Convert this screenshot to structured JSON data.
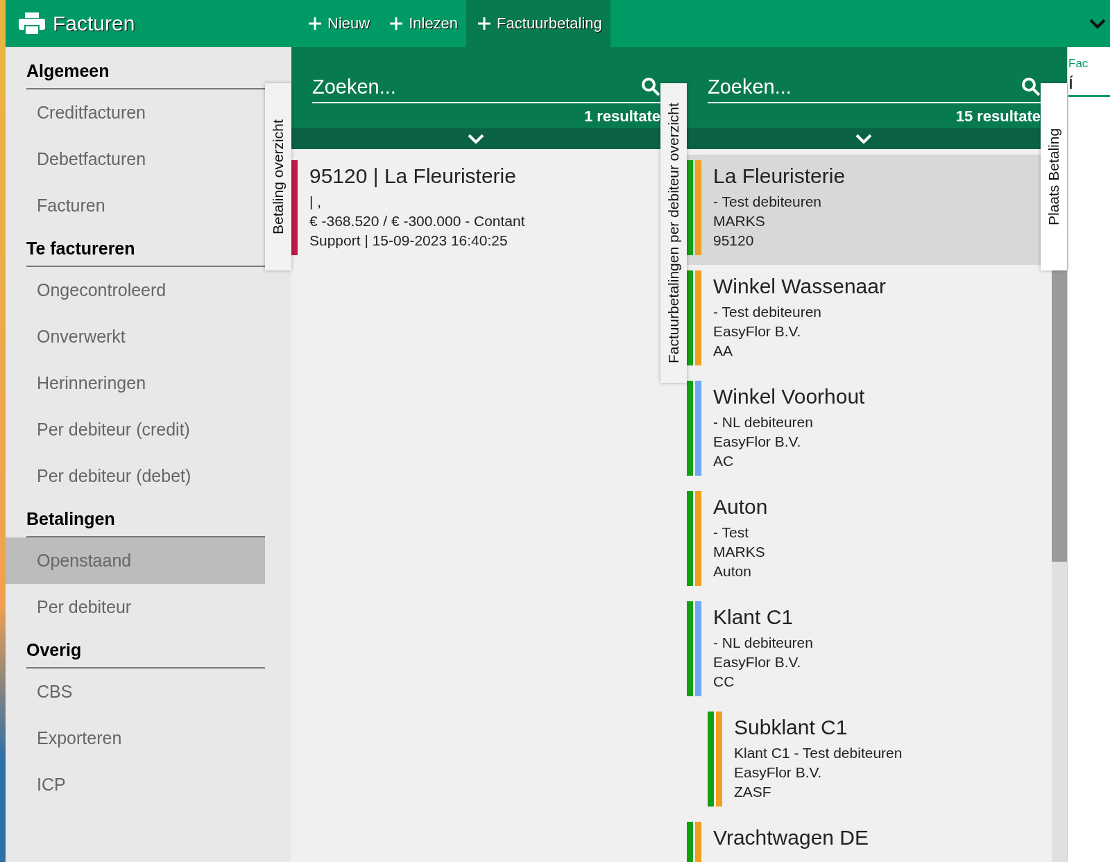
{
  "app": {
    "title": "Facturen"
  },
  "toolbar": [
    {
      "label": "Nieuw",
      "selected": false
    },
    {
      "label": "Inlezen",
      "selected": false
    },
    {
      "label": "Factuurbetaling",
      "selected": true
    }
  ],
  "sidebar": {
    "sections": [
      {
        "heading": "Algemeen",
        "items": [
          {
            "label": "Creditfacturen",
            "selected": false
          },
          {
            "label": "Debetfacturen",
            "selected": false
          },
          {
            "label": "Facturen",
            "selected": false
          }
        ]
      },
      {
        "heading": "Te factureren",
        "items": [
          {
            "label": "Ongecontroleerd",
            "selected": false
          },
          {
            "label": "Onverwerkt",
            "selected": false
          },
          {
            "label": "Herinneringen",
            "selected": false
          },
          {
            "label": "Per debiteur (credit)",
            "selected": false
          },
          {
            "label": "Per debiteur (debet)",
            "selected": false
          }
        ]
      },
      {
        "heading": "Betalingen",
        "items": [
          {
            "label": "Openstaand",
            "selected": true
          },
          {
            "label": "Per debiteur",
            "selected": false
          }
        ]
      },
      {
        "heading": "Overig",
        "items": [
          {
            "label": "CBS",
            "selected": false
          },
          {
            "label": "Exporteren",
            "selected": false
          },
          {
            "label": "ICP",
            "selected": false
          }
        ]
      }
    ]
  },
  "side_tabs": [
    {
      "label": "Betaling overzicht",
      "selected": false
    },
    {
      "label": "Factuurbetalingen per debiteur overzicht",
      "selected": false
    },
    {
      "label": "Plaats Betaling",
      "selected": true
    }
  ],
  "payments_panel": {
    "search": {
      "placeholder": "Zoeken..."
    },
    "result_count": "1 resultate",
    "items": [
      {
        "title": "95120 | La Fleuristerie",
        "lines": [
          "| ,",
          "€ -368.520 / € -300.000 - Contant",
          "Support | 15-09-2023 16:40:25"
        ],
        "color": "#c2184a"
      }
    ]
  },
  "debtors_panel": {
    "search": {
      "placeholder": "Zoeken..."
    },
    "result_count": "15 resultate",
    "items": [
      {
        "title": "La Fleuristerie",
        "lines": [
          "- Test debiteuren",
          "MARKS",
          "95120"
        ],
        "color": "#f0a01e",
        "selected": true
      },
      {
        "title": "Winkel Wassenaar",
        "lines": [
          "- Test debiteuren",
          "EasyFlor B.V.",
          "AA"
        ],
        "color": "#f0a01e",
        "selected": false
      },
      {
        "title": "Winkel Voorhout",
        "lines": [
          "- NL debiteuren",
          "EasyFlor B.V.",
          "AC"
        ],
        "color": "#6ea8f2",
        "selected": false
      },
      {
        "title": "Auton",
        "lines": [
          "- Test",
          "MARKS",
          "Auton"
        ],
        "color": "#f0a01e",
        "selected": false
      },
      {
        "title": "Klant C1",
        "lines": [
          "- NL debiteuren",
          "EasyFlor B.V.",
          "CC"
        ],
        "color": "#6ea8f2",
        "selected": false,
        "children": [
          {
            "title": "Subklant C1",
            "lines": [
              "Klant C1 - Test debiteuren",
              "EasyFlor B.V.",
              "ZASF"
            ],
            "color": "#f0a01e",
            "selected": false
          }
        ]
      },
      {
        "title": "Vrachtwagen DE",
        "color": "#f0a01e",
        "selected": false
      }
    ]
  },
  "payment_form": {
    "field_label": "Fac",
    "value": "í"
  }
}
